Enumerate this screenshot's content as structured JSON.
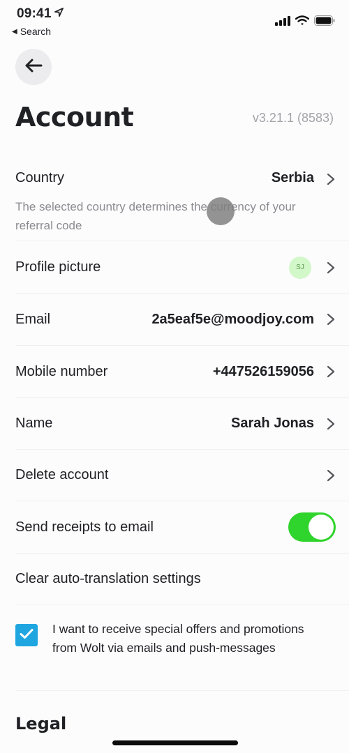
{
  "status_bar": {
    "time": "09:41",
    "back_label": "Search",
    "icons": [
      "location-arrow-icon",
      "cellular-signal-icon",
      "wifi-icon",
      "battery-icon"
    ]
  },
  "header": {
    "back_icon": "arrow-left-icon",
    "title": "Account",
    "version": "v3.21.1 (8583)"
  },
  "settings": {
    "country": {
      "label": "Country",
      "value": "Serbia",
      "description": "The selected country determines the currency of your referral code"
    },
    "profile_picture": {
      "label": "Profile picture",
      "avatar_initials": "SJ",
      "avatar_color": "#d2f7c9"
    },
    "email": {
      "label": "Email",
      "value": "2a5eaf5e@moodjoy.com"
    },
    "mobile": {
      "label": "Mobile number",
      "value": "+447526159056"
    },
    "name": {
      "label": "Name",
      "value": "Sarah Jonas"
    },
    "delete_account": {
      "label": "Delete account"
    },
    "send_receipts": {
      "label": "Send receipts to email",
      "enabled": true,
      "toggle_color": "#2fd42c"
    },
    "clear_translation": {
      "label": "Clear auto-translation settings"
    },
    "offers": {
      "checked": true,
      "text": "I want to receive special offers and promotions from Wolt via emails and push-messages",
      "checkbox_color": "#1fa6e0"
    }
  },
  "legal": {
    "title": "Legal"
  }
}
